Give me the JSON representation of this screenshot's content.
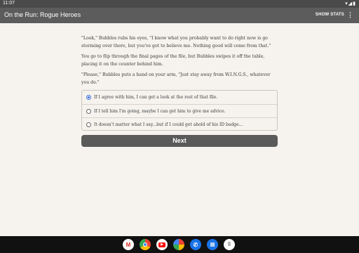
{
  "status": {
    "time": "11:07",
    "icons_text": "▾◢▮"
  },
  "appbar": {
    "title": "On the Run: Rogue Heroes",
    "stats_label": "SHOW STATS",
    "menu_glyph": "⋮"
  },
  "story": {
    "paragraphs": [
      "\"Look,\" Bubbles rubs his eyes, \"I know what you probably want to do right now is go storming over there, but you've got to believe me. Nothing good will come from that.\"",
      "You go to flip through the final pages of the file, but Bubbles swipes it off the table, placing it on the counter behind him.",
      "\"Please,\" Bubbles puts a hand on your arm, \"Just stay away from W.I.N.G.S., whatever you do.\""
    ]
  },
  "choices": {
    "selected_index": 0,
    "items": [
      {
        "label": "If I agree with him, I can get a look at the rest of that file."
      },
      {
        "label": "If I tell him I'm going, maybe I can get him to give me advice."
      },
      {
        "label": "It doesn't matter what I say...but if I could get ahold of his ID badge..."
      }
    ]
  },
  "next_button": {
    "label": "Next"
  },
  "dock": {
    "apps": [
      {
        "name": "gmail-icon",
        "glyph": "M"
      },
      {
        "name": "chrome-icon",
        "glyph": ""
      },
      {
        "name": "youtube-icon",
        "glyph": "▶"
      },
      {
        "name": "photos-icon",
        "glyph": ""
      },
      {
        "name": "phone-icon",
        "glyph": "✆"
      },
      {
        "name": "messages-icon",
        "glyph": "▤"
      },
      {
        "name": "app-drawer-icon",
        "glyph": "⠿"
      }
    ]
  },
  "colors": {
    "appbar": "#5c5c5c",
    "background": "#f6f3ee",
    "accent": "#3b6fd8",
    "button": "#5a5a5a"
  }
}
